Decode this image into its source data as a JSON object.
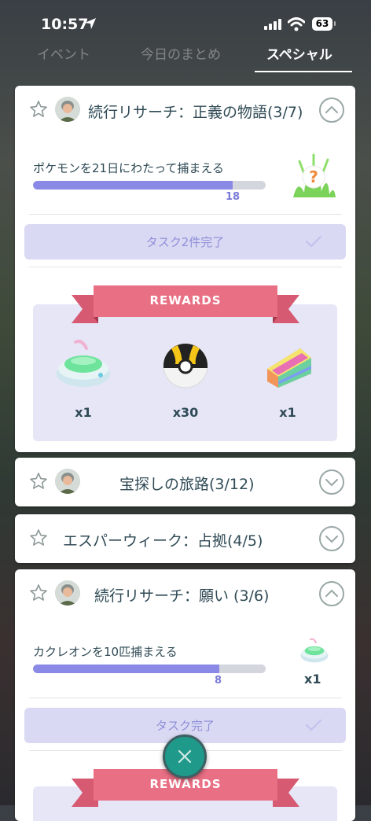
{
  "status_bar": {
    "time": "10:57",
    "battery": "63"
  },
  "tabs": [
    {
      "label": "イベント",
      "active": false
    },
    {
      "label": "今日のまとめ",
      "active": false
    },
    {
      "label": "スペシャル",
      "active": true
    }
  ],
  "cards": [
    {
      "title": "続行リサーチ：正義の物語(3/7)",
      "expanded": true,
      "task": {
        "text": "ポケモンを21日にわたって捕まえる",
        "progress": 18,
        "goal": 21,
        "reward_icon": "mystery-pokemon-icon"
      },
      "completed_label": "タスク2件完了",
      "rewards_label": "REWARDS",
      "rewards": [
        {
          "icon": "incense-icon",
          "qty": "x1"
        },
        {
          "icon": "ultra-ball-icon",
          "qty": "x30"
        },
        {
          "icon": "rare-candy-xl-icon",
          "qty": "x1"
        }
      ]
    },
    {
      "title": "宝探しの旅路(3/12)",
      "expanded": false
    },
    {
      "title": "エスパーウィーク：占拠(4/5)",
      "expanded": false
    },
    {
      "title": "続行リサーチ：願い (3/6)",
      "expanded": true,
      "task": {
        "text": "カクレオンを10匹捕まえる",
        "progress": 8,
        "goal": 10,
        "reward_icon": "incense-icon",
        "reward_qty": "x1"
      },
      "completed_label": "タスク完了",
      "rewards_label": "REWARDS"
    }
  ],
  "colors": {
    "accent": "#8a8ae6",
    "ribbon": "#e86f84",
    "close_button": "#1f9a8a"
  }
}
